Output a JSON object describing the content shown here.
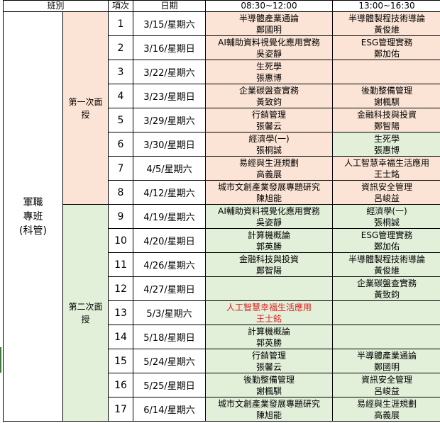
{
  "header": {
    "class": "班別",
    "item": "項次",
    "date": "日期",
    "morning": "08:30~12:00",
    "afternoon": "13:00~16:30"
  },
  "class_name": "軍職專班(科管)",
  "class_name_lines": [
    "軍職",
    "專班",
    "(科管)"
  ],
  "phases": [
    {
      "label": "第一次面授"
    },
    {
      "label": "第二次面授"
    }
  ],
  "rows": [
    {
      "no": "1",
      "date": "3/15/星期六",
      "am": {
        "course": "半導體產業通論",
        "teacher": "鄭國明"
      },
      "pm": {
        "course": "半導體製程技術導論",
        "teacher": "黃俊維"
      }
    },
    {
      "no": "2",
      "date": "3/16/星期日",
      "am": {
        "course": "AI輔助資料視覺化應用實務",
        "teacher": "吳姿靜"
      },
      "pm": {
        "course": "ESG管理實務",
        "teacher": "鄭加佑"
      }
    },
    {
      "no": "3",
      "date": "3/22/星期六",
      "am": {
        "course": "生死學",
        "teacher": "張惠博"
      },
      "pm": {
        "course": "",
        "teacher": ""
      }
    },
    {
      "no": "4",
      "date": "3/23/星期日",
      "am": {
        "course": "企業碳盤查實務",
        "teacher": "黃致鈞"
      },
      "pm": {
        "course": "後勤整備管理",
        "teacher": "謝楓騏"
      }
    },
    {
      "no": "5",
      "date": "3/29/星期六",
      "am": {
        "course": "行銷管理",
        "teacher": "張馨云"
      },
      "pm": {
        "course": "金融科技與投資",
        "teacher": "鄭智陽"
      }
    },
    {
      "no": "6",
      "date": "3/30/星期日",
      "am": {
        "course": "經濟學(一)",
        "teacher": "張桐誠"
      },
      "pm": {
        "course": "生死學",
        "teacher": "張惠博"
      }
    },
    {
      "no": "7",
      "date": "4/5/星期六",
      "am": {
        "course": "易經與生涯規劃",
        "teacher": "高義展"
      },
      "pm": {
        "course": "人工智慧幸福生活應用",
        "teacher": "王士銘"
      }
    },
    {
      "no": "8",
      "date": "4/12/星期六",
      "am": {
        "course": "城市文創產業發展專題研究",
        "teacher": "陳旭能"
      },
      "pm": {
        "course": "資訊安全管理",
        "teacher": "呂峻益"
      }
    },
    {
      "no": "9",
      "date": "4/19/星期六",
      "am": {
        "course": "AI輔助資料視覺化應用實務",
        "teacher": "吳姿靜"
      },
      "pm": {
        "course": "經濟學(一)",
        "teacher": "張桐誠"
      }
    },
    {
      "no": "10",
      "date": "4/20/星期日",
      "am": {
        "course": "計算機概論",
        "teacher": "郭英勝"
      },
      "pm": {
        "course": "ESG管理實務",
        "teacher": "鄭加佑"
      }
    },
    {
      "no": "11",
      "date": "4/26/星期六",
      "am": {
        "course": "金融科技與投資",
        "teacher": "鄭智陽"
      },
      "pm": {
        "course": "半導體製程技術導論",
        "teacher": "黃俊維"
      }
    },
    {
      "no": "12",
      "date": "4/27/星期日",
      "am": {
        "course": "",
        "teacher": ""
      },
      "pm": {
        "course": "企業碳盤查實務",
        "teacher": "黃致鈞"
      }
    },
    {
      "no": "13",
      "date": "5/3/星期六",
      "am": {
        "course": "人工智慧幸福生活應用",
        "teacher": "王士銘"
      },
      "pm": {
        "course": "",
        "teacher": ""
      }
    },
    {
      "no": "14",
      "date": "5/18/星期日",
      "am": {
        "course": "計算機概論",
        "teacher": "郭英勝"
      },
      "pm": {
        "course": "",
        "teacher": ""
      }
    },
    {
      "no": "15",
      "date": "5/24/星期六",
      "am": {
        "course": "行銷管理",
        "teacher": "張馨云"
      },
      "pm": {
        "course": "半導體產業通論",
        "teacher": "鄭國明"
      }
    },
    {
      "no": "16",
      "date": "5/25/星期日",
      "am": {
        "course": "後勤整備管理",
        "teacher": "謝楓騏"
      },
      "pm": {
        "course": "資訊安全管理",
        "teacher": "呂峻益"
      }
    },
    {
      "no": "17",
      "date": "6/14/星期六",
      "am": {
        "course": "城市文創產業發展專題研究",
        "teacher": "陳旭能"
      },
      "pm": {
        "course": "易經與生涯規劃",
        "teacher": "高義展"
      }
    }
  ],
  "colors": {
    "phase1_fill": "#fbe4d5",
    "phase2_fill": "#e2efd9",
    "highlight_text": "#e02020"
  }
}
